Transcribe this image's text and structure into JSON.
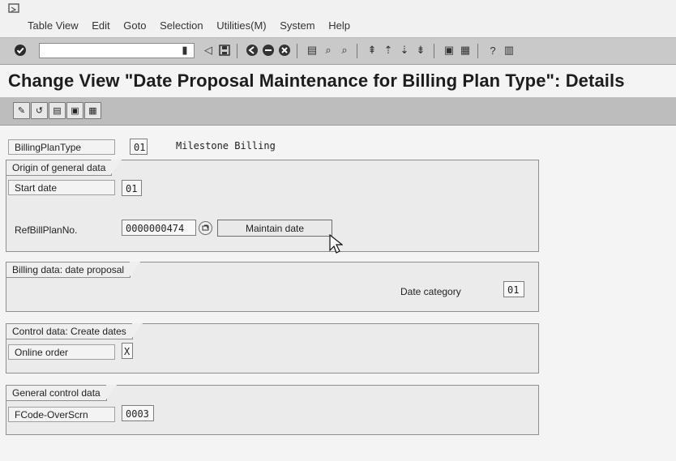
{
  "menu": {
    "items": [
      "Table View",
      "Edit",
      "Goto",
      "Selection",
      "Utilities(M)",
      "System",
      "Help"
    ]
  },
  "toolbar": {
    "command_field_value": ""
  },
  "page": {
    "title": "Change View \"Date Proposal Maintenance for Billing Plan Type\": Details"
  },
  "billing_plan_type": {
    "label": "BillingPlanType",
    "value": "01",
    "description": "Milestone Billing"
  },
  "groups": {
    "origin": {
      "title": "Origin of general data",
      "start_date_label": "Start date",
      "start_date_value": "01",
      "ref_label": "RefBillPlanNo.",
      "ref_value": "0000000474",
      "maintain_button": "Maintain date"
    },
    "billing": {
      "title": "Billing data: date proposal",
      "date_category_label": "Date category",
      "date_category_value": "01"
    },
    "control": {
      "title": "Control data: Create dates",
      "online_order_label": "Online order",
      "online_order_value": "X"
    },
    "general": {
      "title": "General control data",
      "fcode_label": "FCode-OverScrn",
      "fcode_value": "0003"
    }
  },
  "colors": {
    "toolbar_gray": "#c9c9c9",
    "panel_gray": "#ebebeb",
    "accent_dark": "#1d1d1d"
  }
}
